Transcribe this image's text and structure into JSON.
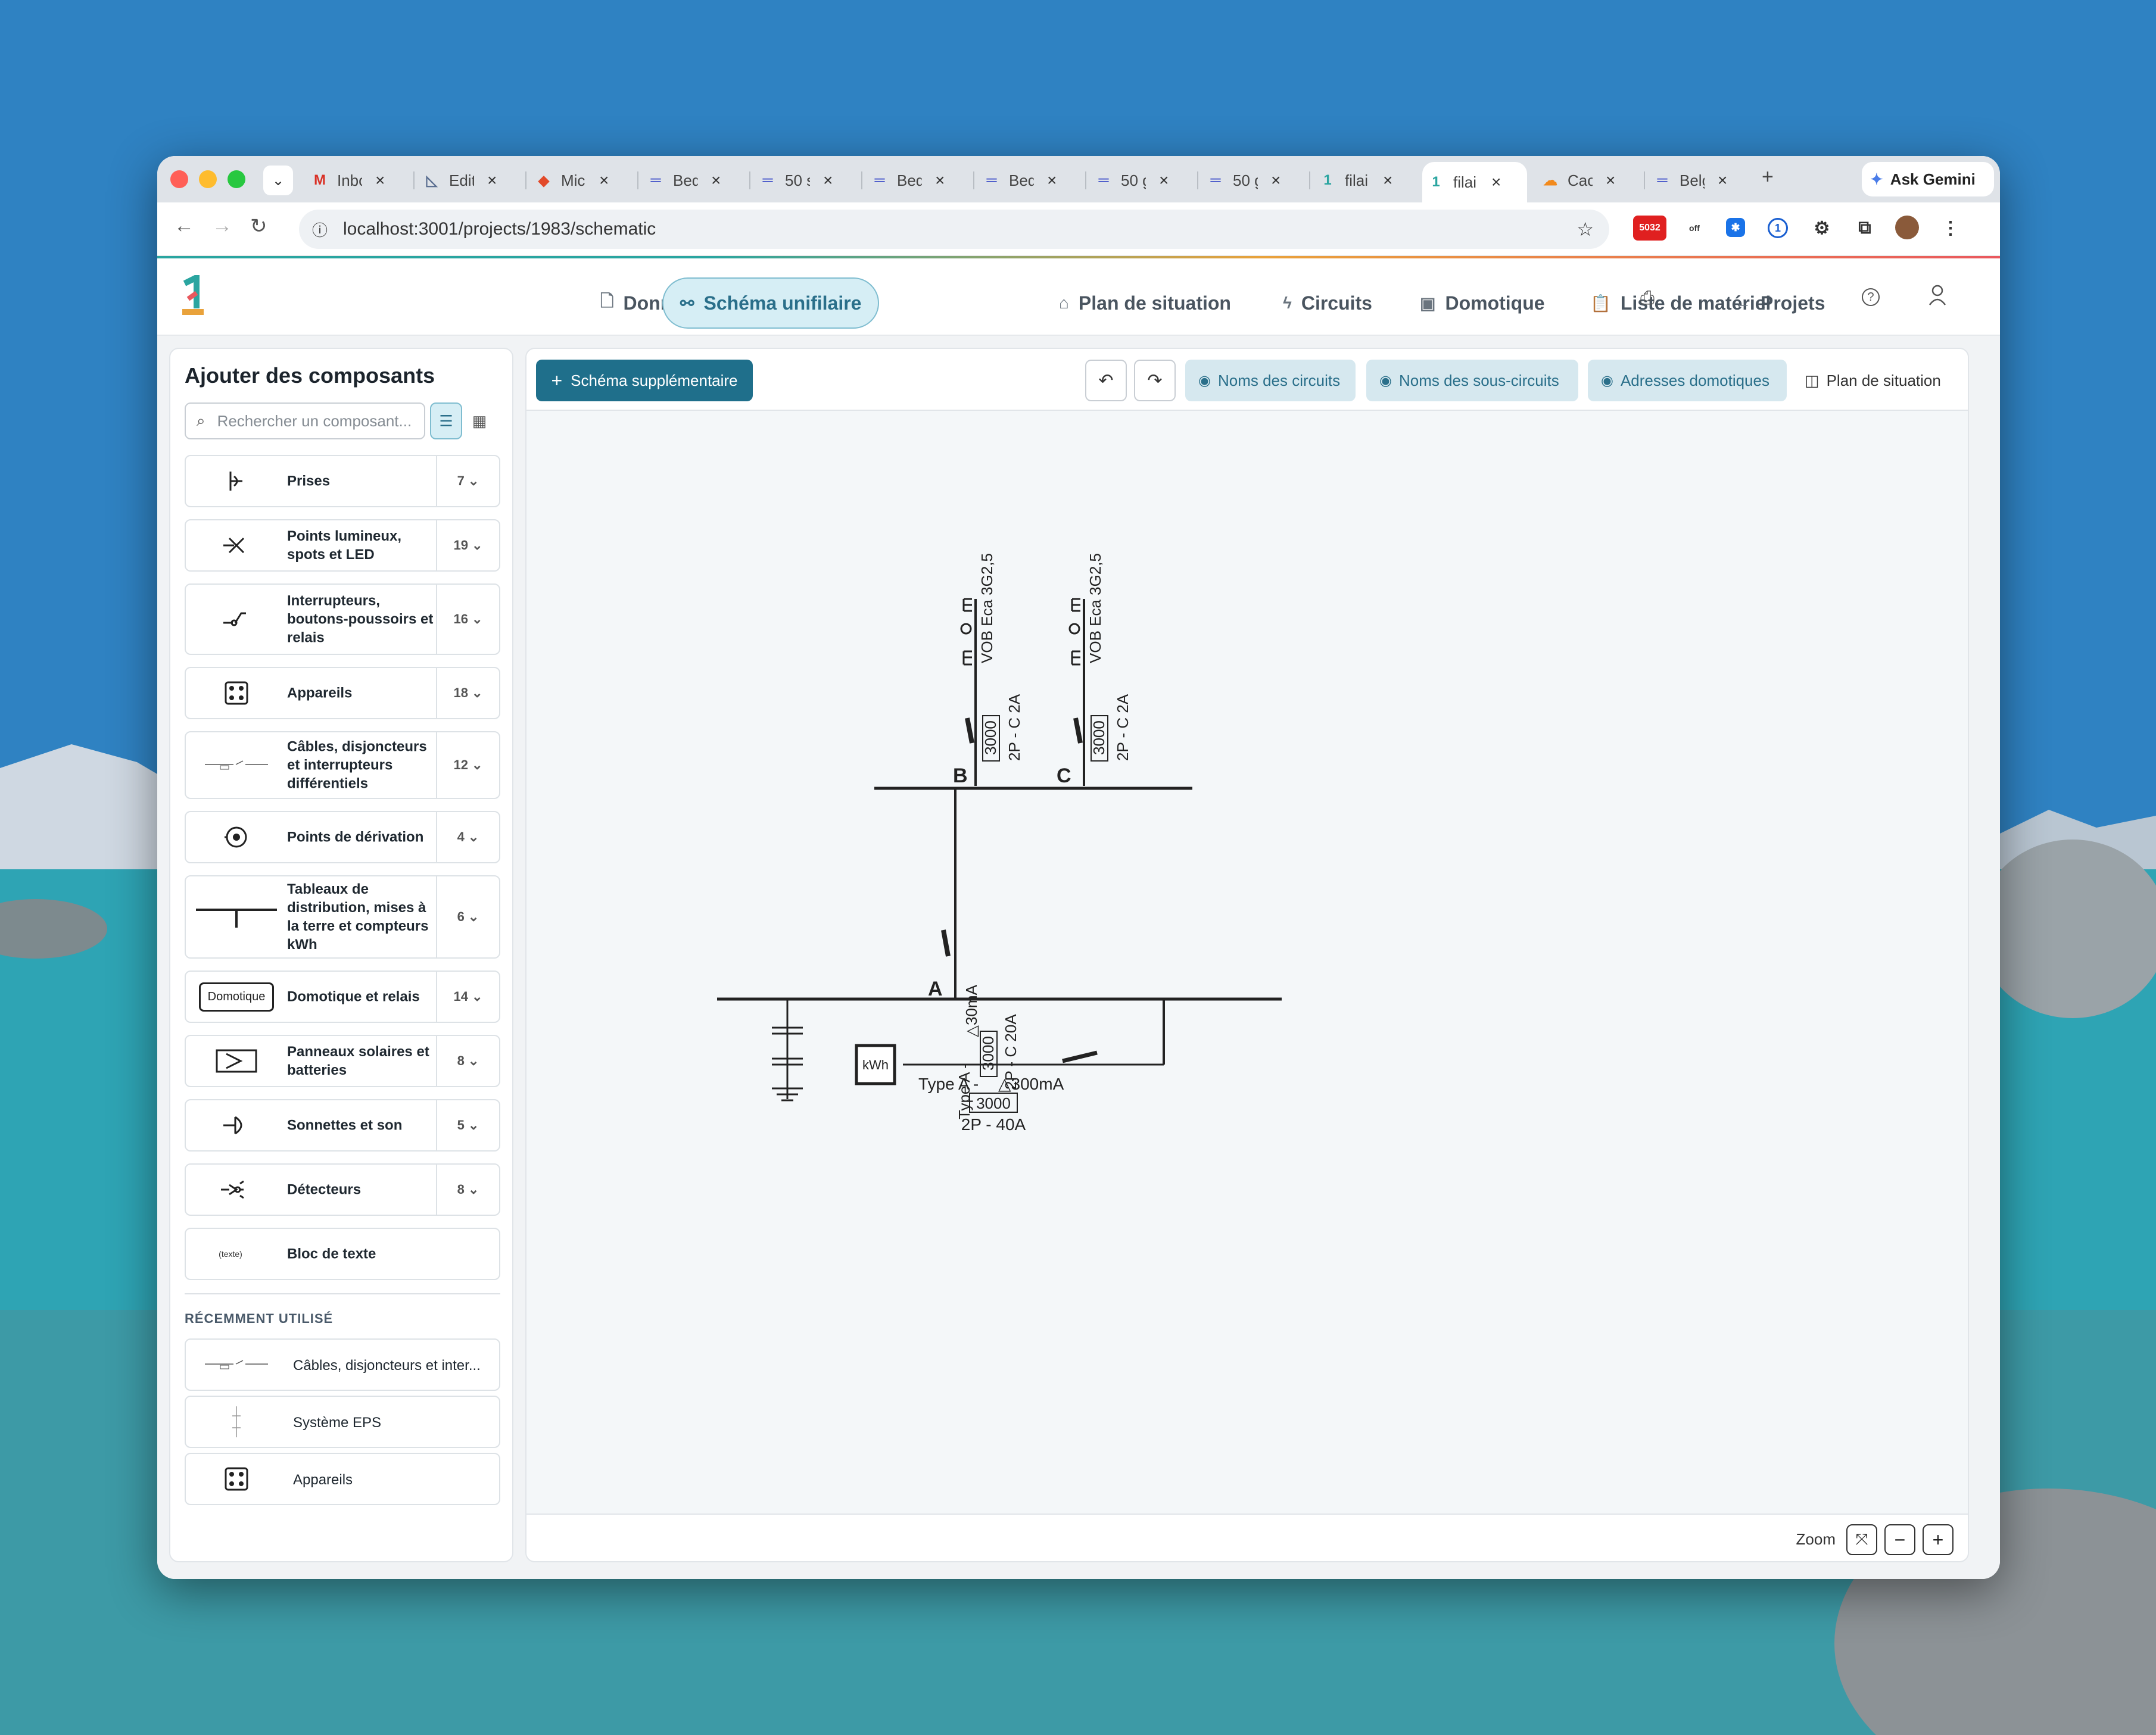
{
  "browser": {
    "tabs": [
      {
        "label": "Inbo",
        "icon": "gmail-icon"
      },
      {
        "label": "Edit",
        "icon": "drafting-icon"
      },
      {
        "label": "Micr",
        "icon": "office-icon"
      },
      {
        "label": "Bed",
        "icon": "linear-icon"
      },
      {
        "label": "50 s",
        "icon": "linear-icon"
      },
      {
        "label": "Bed",
        "icon": "linear-icon"
      },
      {
        "label": "Bed",
        "icon": "linear-icon"
      },
      {
        "label": "50 g",
        "icon": "linear-icon"
      },
      {
        "label": "50 g",
        "icon": "linear-icon"
      },
      {
        "label": "filai",
        "icon": "app-logo-icon"
      },
      {
        "label": "filai",
        "icon": "app-logo-icon"
      },
      {
        "label": "Cac",
        "icon": "cloud-icon"
      },
      {
        "label": "Belg",
        "icon": "linear-icon"
      }
    ],
    "ask_gemini": "Ask Gemini",
    "url": "localhost:3001/projects/1983/schematic",
    "ext_badge": "5032",
    "ext_off": "off"
  },
  "app": {
    "nav": [
      {
        "label": "Données du projet",
        "icon": "document-icon"
      },
      {
        "label": "Schéma unifilaire",
        "icon": "schematic-icon"
      },
      {
        "label": "Plan de situation",
        "icon": "house-icon"
      },
      {
        "label": "Circuits",
        "icon": "bolt-icon"
      },
      {
        "label": "Domotique",
        "icon": "chip-icon"
      },
      {
        "label": "Liste de matériel",
        "icon": "clipboard-icon"
      }
    ],
    "projects": "Projets",
    "active_nav": "Schéma unifilaire"
  },
  "sidebar": {
    "title": "Ajouter des composants",
    "search_placeholder": "Rechercher un composant...",
    "categories": [
      {
        "label": "Prises",
        "count": "7"
      },
      {
        "label": "Points lumineux, spots et LED",
        "count": "19"
      },
      {
        "label": "Interrupteurs, boutons-poussoirs et relais",
        "count": "16"
      },
      {
        "label": "Appareils",
        "count": "18"
      },
      {
        "label": "Câbles, disjoncteurs et interrupteurs différentiels",
        "count": "12"
      },
      {
        "label": "Points de dérivation",
        "count": "4"
      },
      {
        "label": "Tableaux de distribution, mises à la terre et compteurs kWh",
        "count": "6"
      },
      {
        "label": "Domotique et relais",
        "count": "14"
      },
      {
        "label": "Panneaux solaires et batteries",
        "count": "8"
      },
      {
        "label": "Sonnettes et son",
        "count": "5"
      },
      {
        "label": "Détecteurs",
        "count": "8"
      },
      {
        "label": "Bloc de texte",
        "count": ""
      }
    ],
    "domotique_icon_text": "Domotique",
    "texte_icon_text": "(texte)",
    "recent_title": "RÉCEMMENT UTILISÉ",
    "recent": [
      {
        "label": "Câbles, disjoncteurs et inter..."
      },
      {
        "label": "Système EPS"
      },
      {
        "label": "Appareils"
      }
    ]
  },
  "toolbar": {
    "add_schema": "Schéma supplémentaire",
    "toggle_circuit_names": "Noms des circuits",
    "toggle_subcircuit_names": "Noms des sous-circuits",
    "toggle_domotic_addresses": "Adresses domotiques",
    "plan_de_situation": "Plan de situation",
    "zoom": "Zoom"
  },
  "schematic": {
    "label_A": "A",
    "label_B": "B",
    "label_C": "C",
    "cable_B": "VOB Eca 3G2,5",
    "cable_C": "VOB Eca 3G2,5",
    "breaker_B_rating": "3000",
    "breaker_B_spec": "2P - C 2A",
    "breaker_C_rating": "3000",
    "breaker_C_spec": "2P - C 2A",
    "diff_A_type": "Type A -",
    "diff_A_sens": "△30mA",
    "diff_A_rating": "3000",
    "diff_A_spec": "2P - C 20A",
    "kwh": "kWh",
    "main_type": "Type A -",
    "main_sens": "△300mA",
    "main_rating": "3000",
    "main_spec": "2P - 40A"
  },
  "colors": {
    "accent": "#1f6f8b",
    "active_nav_bg": "#d6eef5"
  }
}
